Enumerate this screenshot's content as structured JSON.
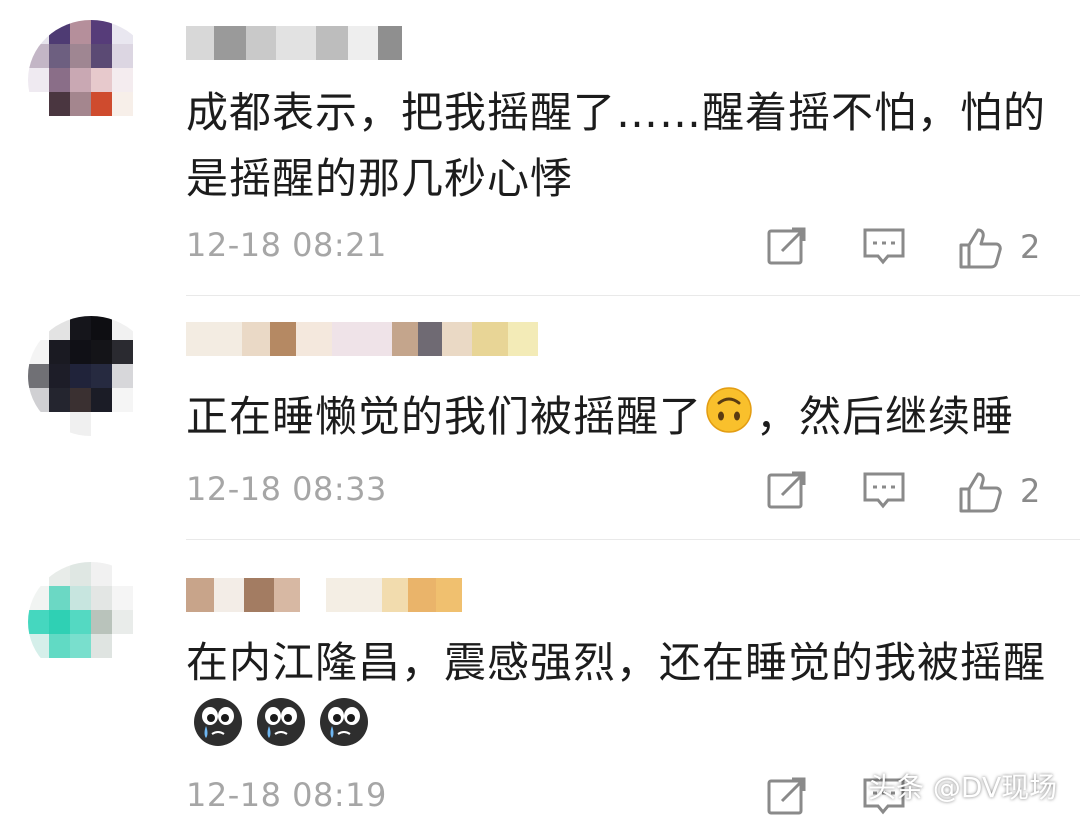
{
  "comments": [
    {
      "text": "成都表示，把我摇醒了……醒着摇不怕，怕的是摇醒的那几秒心悸",
      "time": "12-18 08:21",
      "likes": "2"
    },
    {
      "text_before_emoji": "正在睡懒觉的我们被摇醒了",
      "text_after_emoji": "，然后继续睡",
      "emoji": "upside-down-face-emoji",
      "time": "12-18 08:33",
      "likes": "2"
    },
    {
      "text": "在内江隆昌，震感强烈，还在睡觉的我被摇醒",
      "emojis": [
        "crying-face-emoji",
        "crying-face-emoji",
        "crying-face-emoji"
      ],
      "time": "12-18 08:19"
    }
  ],
  "icons": {
    "share": "share-icon",
    "reply": "comment-icon",
    "like": "thumbs-up-icon"
  },
  "watermark": "头条 @DV现场",
  "colors": {
    "text": "#1c1c1c",
    "meta": "#a6a6a6",
    "icon": "#8a8a8a",
    "divider": "#e9e9e9"
  }
}
